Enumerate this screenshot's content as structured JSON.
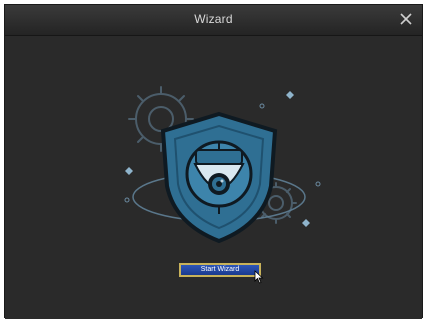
{
  "window": {
    "title": "Wizard",
    "close_glyph": "✕"
  },
  "illustration": {
    "icons": [
      "gear-icon",
      "shield-icon",
      "dome-camera-icon",
      "orbit-ring",
      "sparkle-icon"
    ],
    "colors": {
      "background": "#2a2a2a",
      "line": "#5f7f96",
      "shield_fill": "#2f6f93",
      "shield_edge": "#0f1a22"
    }
  },
  "actions": {
    "start_wizard_label": "Start Wizard"
  },
  "colors": {
    "button_border": "#c8b25a",
    "button_fill": "#1f43a2",
    "title_text": "#d8d8d8"
  }
}
